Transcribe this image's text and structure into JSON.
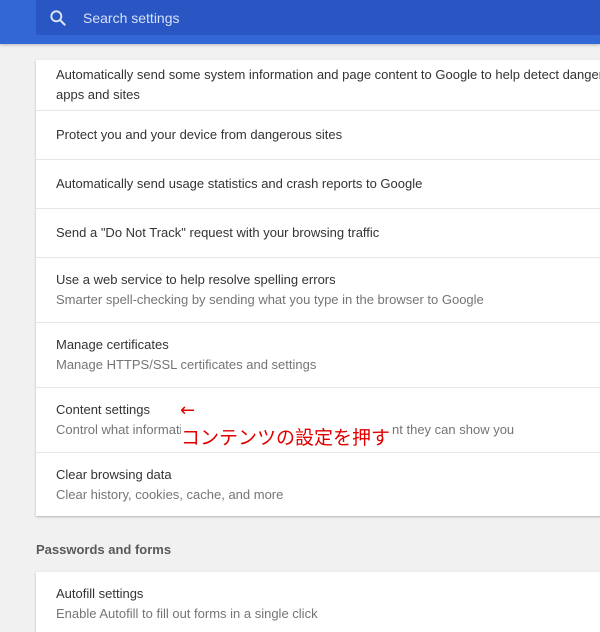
{
  "search": {
    "placeholder": "Search settings",
    "icon": "search-icon"
  },
  "privacy_rows": [
    {
      "primary": "Automatically send some system information and page content to Google to help detect dangerous",
      "primary_line2": "apps and sites"
    },
    {
      "primary": "Protect you and your device from dangerous sites"
    },
    {
      "primary": "Automatically send usage statistics and crash reports to Google"
    },
    {
      "primary": "Send a \"Do Not Track\" request with your browsing traffic"
    },
    {
      "primary": "Use a web service to help resolve spelling errors",
      "secondary": "Smarter spell-checking by sending what you type in the browser to Google"
    },
    {
      "primary": "Manage certificates",
      "secondary": "Manage HTTPS/SSL certificates and settings"
    },
    {
      "primary": "Content settings",
      "secondary": "Control what information websites can use and what content they can show you"
    },
    {
      "primary": "Clear browsing data",
      "secondary": "Clear history, cookies, cache, and more"
    }
  ],
  "passwords_section": {
    "title": "Passwords and forms",
    "rows": [
      {
        "primary": "Autofill settings",
        "secondary": "Enable Autofill to fill out forms in a single click"
      }
    ]
  },
  "annotation": {
    "arrow": "←",
    "text": "コンテンツの設定を押す"
  },
  "colors": {
    "topbar": "#3367d6",
    "annotation": "#e00000"
  }
}
